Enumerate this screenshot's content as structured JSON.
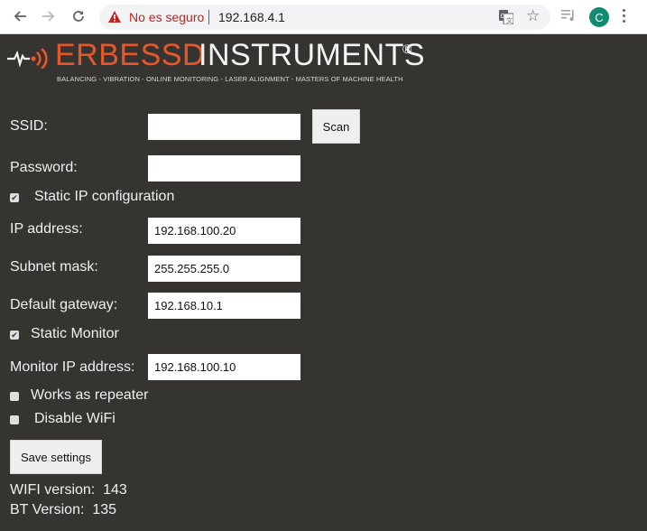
{
  "browser": {
    "security_status": "No es seguro",
    "url": "192.168.4.1",
    "profile_initial": "C",
    "icons": [
      "back-icon",
      "forward-icon",
      "reload-icon",
      "warning-icon",
      "translate-icon",
      "star-icon",
      "media-control-icon",
      "menu-icon"
    ]
  },
  "logo": {
    "brand_primary": "ERBESSD",
    "brand_secondary": "INSTRUMENTS",
    "registered": "®",
    "tagline": "BALANCING - VIBRATION - ONLINE MONITORING - LASER ALIGNMENT - MASTERS OF MACHINE HEALTH",
    "accent_color": "#e8572a"
  },
  "form": {
    "ssid": {
      "label": "SSID:",
      "value": ""
    },
    "scan_button": "Scan",
    "password": {
      "label": "Password:",
      "value": ""
    },
    "static_ip": {
      "label": "Static IP configuration",
      "checked": true
    },
    "ip_address": {
      "label": "IP address:",
      "value": "192.168.100.20"
    },
    "subnet_mask": {
      "label": "Subnet mask:",
      "value": "255.255.255.0"
    },
    "default_gateway": {
      "label": "Default gateway:",
      "value": "192.168.10.1"
    },
    "static_monitor": {
      "label": "Static Monitor",
      "checked": true
    },
    "monitor_ip": {
      "label": "Monitor IP address:",
      "value": "192.168.100.10"
    },
    "repeater": {
      "label": "Works as repeater",
      "checked": false
    },
    "disable_wifi": {
      "label": "Disable WiFi",
      "checked": false
    },
    "save_button": "Save settings"
  },
  "versions": {
    "wifi_label": "WIFI version:",
    "wifi_value": "143",
    "bt_label": "BT Version:",
    "bt_value": "135"
  },
  "colors": {
    "page_background": "#363431",
    "warning": "#c5221f",
    "avatar": "#138a72"
  }
}
